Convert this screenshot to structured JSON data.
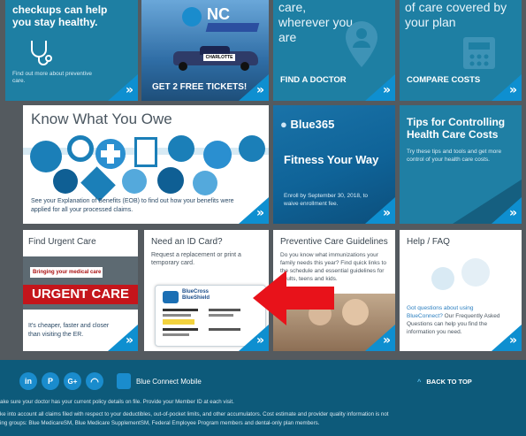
{
  "tiles": {
    "checkups": {
      "title": "checkups can help you stay healthy.",
      "link": "Find out more about preventive care.",
      "chev": "»"
    },
    "tickets": {
      "label": "GET 2 FREE TICKETS!",
      "logo": "NC",
      "car_sign": "CHARLOTTE",
      "chev": "»"
    },
    "doctor": {
      "headline": "care, wherever you are",
      "label": "FIND A DOCTOR",
      "chev": "»"
    },
    "compare": {
      "headline": "of care covered by your plan",
      "label": "COMPARE COSTS",
      "chev": "»"
    },
    "owe": {
      "title": "Know What You Owe",
      "body": "See your Explanation of Benefits (EOB) to find out how your benefits were applied for all your processed claims.",
      "chev": "»"
    },
    "fitness": {
      "brand": "Blue365",
      "title": "Fitness Your Way",
      "body": "Enroll by September 30, 2018, to waive enrollment fee.",
      "chev": "»"
    },
    "tips": {
      "title": "Tips for Controlling Health Care Costs",
      "body": "Try these tips and tools and get more control of your health care costs.",
      "chev": "»"
    },
    "urgent": {
      "title": "Find Urgent Care",
      "sign": "URGENT CARE",
      "sign2": "Bringing your medical care",
      "body": "It's cheaper, faster and closer than visiting the ER.",
      "chev": "»"
    },
    "idcard": {
      "title": "Need an ID Card?",
      "body": "Request a replacement or print a temporary card.",
      "card_brand": "BlueCross BlueShield",
      "chev": "»"
    },
    "guidelines": {
      "title": "Preventive Care Guidelines",
      "body": "Do you know what immunizations your family needs this year? Find quick links to the schedule and essential guidelines for adults, teens and kids.",
      "chev": "»"
    },
    "faq": {
      "title": "Help / FAQ",
      "body_link": "Got questions about using BlueConnect?",
      "body": "Our Frequently Asked Questions can help you find the information you need.",
      "chev": "»"
    }
  },
  "footer": {
    "social": [
      "in",
      "P",
      "G+",
      "RSS"
    ],
    "mobile_label": "Blue Connect Mobile",
    "back_to_top": "BACK TO TOP",
    "line1": "ake sure your doctor has your current policy details on file. Provide your Member ID at each visit.",
    "line2": "ke into account all claims filed with respect to your deductibles, out-of-pocket limits, and other accumulators. Cost estimate and provider quality information is not",
    "line3": "ing groups: Blue MedicareSM, Blue Medicare SupplementSM, Federal Employee Program members and dental-only plan members."
  },
  "colors": {
    "accent": "#0e8fd0",
    "arrow": "#e8121a",
    "tile_teal": "#1e7fa3",
    "footer": "#0d5a7a"
  }
}
